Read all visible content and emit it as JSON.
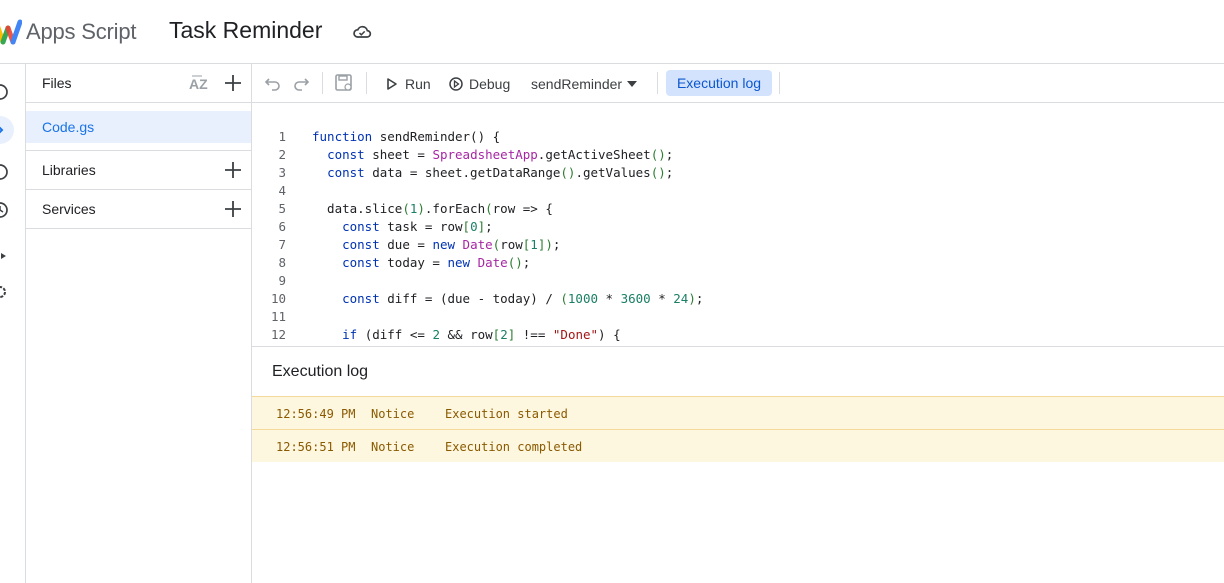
{
  "header": {
    "app_name": "Apps Script",
    "project_title": "Task Reminder"
  },
  "files_panel": {
    "files_label": "Files",
    "files": [
      "Code.gs"
    ],
    "libraries_label": "Libraries",
    "services_label": "Services"
  },
  "toolbar": {
    "run_label": "Run",
    "debug_label": "Debug",
    "function_select": "sendReminder",
    "execution_log_label": "Execution log"
  },
  "editor": {
    "lines": [
      {
        "n": "1",
        "code": "function sendReminder() {"
      },
      {
        "n": "2",
        "code": "  const sheet = SpreadsheetApp.getActiveSheet();"
      },
      {
        "n": "3",
        "code": "  const data = sheet.getDataRange().getValues();"
      },
      {
        "n": "4",
        "code": ""
      },
      {
        "n": "5",
        "code": "  data.slice(1).forEach(row => {"
      },
      {
        "n": "6",
        "code": "    const task = row[0];"
      },
      {
        "n": "7",
        "code": "    const due = new Date(row[1]);"
      },
      {
        "n": "8",
        "code": "    const today = new Date();"
      },
      {
        "n": "9",
        "code": ""
      },
      {
        "n": "10",
        "code": "    const diff = (due - today) / (1000 * 3600 * 24);"
      },
      {
        "n": "11",
        "code": ""
      },
      {
        "n": "12",
        "code": "    if (diff <= 2 && row[2] !== \"Done\") {"
      }
    ]
  },
  "execution_log": {
    "title": "Execution log",
    "entries": [
      {
        "time": "12:56:49 PM",
        "level": "Notice",
        "message": "Execution started"
      },
      {
        "time": "12:56:51 PM",
        "level": "Notice",
        "message": "Execution completed"
      }
    ]
  },
  "colors": {
    "accent": "#1a73e8",
    "selected_bg": "#e8f0fe",
    "log_notice_bg": "#fef7e0"
  }
}
